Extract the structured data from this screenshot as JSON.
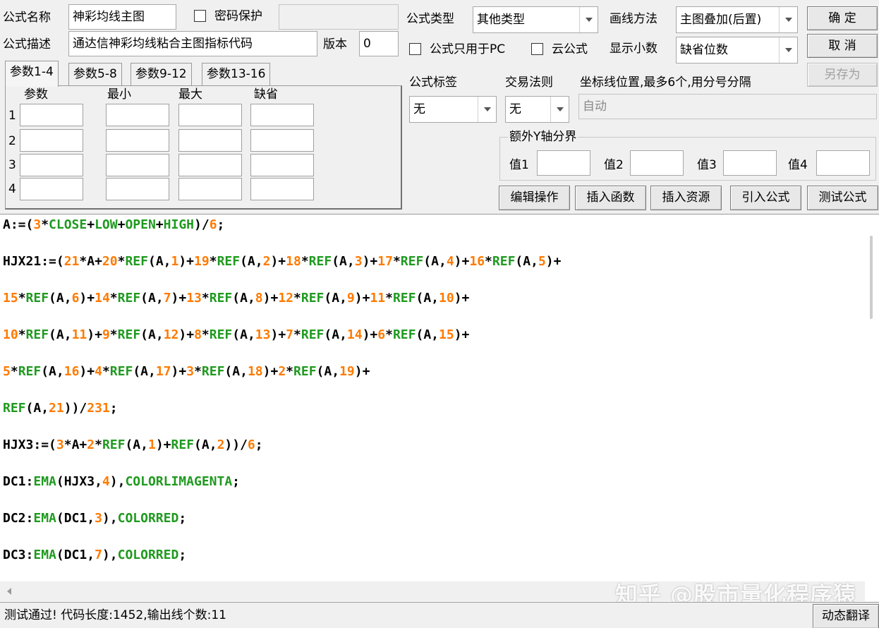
{
  "header": {
    "name_label": "公式名称",
    "name_value": "神彩均线主图",
    "password_label": "密码保护",
    "password_value": "",
    "desc_label": "公式描述",
    "desc_value": "通达信神彩均线粘合主图指标代码",
    "version_label": "版本",
    "version_value": "0"
  },
  "settings": {
    "type_label": "公式类型",
    "type_value": "其他类型",
    "draw_label": "画线方法",
    "draw_value": "主图叠加(后置)",
    "pc_only_label": "公式只用于PC",
    "cloud_label": "云公式",
    "decimal_label": "显示小数",
    "decimal_value": "缺省位数",
    "tag_label": "公式标签",
    "tag_value": "无",
    "trade_label": "交易法则",
    "trade_value": "无",
    "coord_label": "坐标线位置,最多6个,用分号分隔",
    "coord_placeholder": "自动",
    "yaxis_group_label": "额外Y轴分界",
    "yaxis_values": [
      {
        "label": "值1",
        "value": ""
      },
      {
        "label": "值2",
        "value": ""
      },
      {
        "label": "值3",
        "value": ""
      },
      {
        "label": "值4",
        "value": ""
      }
    ]
  },
  "buttons": {
    "ok": "确  定",
    "cancel": "取  消",
    "save_as": "另存为",
    "edit": "编辑操作",
    "insert_func": "插入函数",
    "insert_res": "插入资源",
    "import": "引入公式",
    "test": "测试公式"
  },
  "params": {
    "tabs": [
      "参数1-4",
      "参数5-8",
      "参数9-12",
      "参数13-16"
    ],
    "active_tab": 0,
    "headers": [
      "参数",
      "最小",
      "最大",
      "缺省"
    ],
    "row_labels": [
      "1",
      "2",
      "3",
      "4"
    ]
  },
  "editor": {
    "lines": [
      "A:=(3*CLOSE+LOW+OPEN+HIGH)/6;",
      "HJX21:=(21*A+20*REF(A,1)+19*REF(A,2)+18*REF(A,3)+17*REF(A,4)+16*REF(A,5)+",
      "15*REF(A,6)+14*REF(A,7)+13*REF(A,8)+12*REF(A,9)+11*REF(A,10)+",
      "10*REF(A,11)+9*REF(A,12)+8*REF(A,13)+7*REF(A,14)+6*REF(A,15)+",
      "5*REF(A,16)+4*REF(A,17)+3*REF(A,18)+2*REF(A,19)+",
      "REF(A,21))/231;",
      "HJX3:=(3*A+2*REF(A,1)+REF(A,2))/6;",
      "DC1:EMA(HJX3,4),COLORLIMAGENTA;",
      "DC2:EMA(DC1,3),COLORRED;",
      "DC3:EMA(DC1,7),COLORRED;"
    ],
    "keywords": [
      "CLOSE",
      "LOW",
      "OPEN",
      "HIGH",
      "REF",
      "EMA",
      "COLORLIMAGENTA",
      "COLORRED"
    ],
    "colors": {
      "number": "#ff7a00",
      "keyword": "#1f9a1f",
      "default": "#000000"
    }
  },
  "watermark": "知乎 @股市量化程序猿",
  "status": {
    "message": "测试通过! 代码长度:1452,输出线个数:11",
    "translate_button": "动态翻译"
  }
}
